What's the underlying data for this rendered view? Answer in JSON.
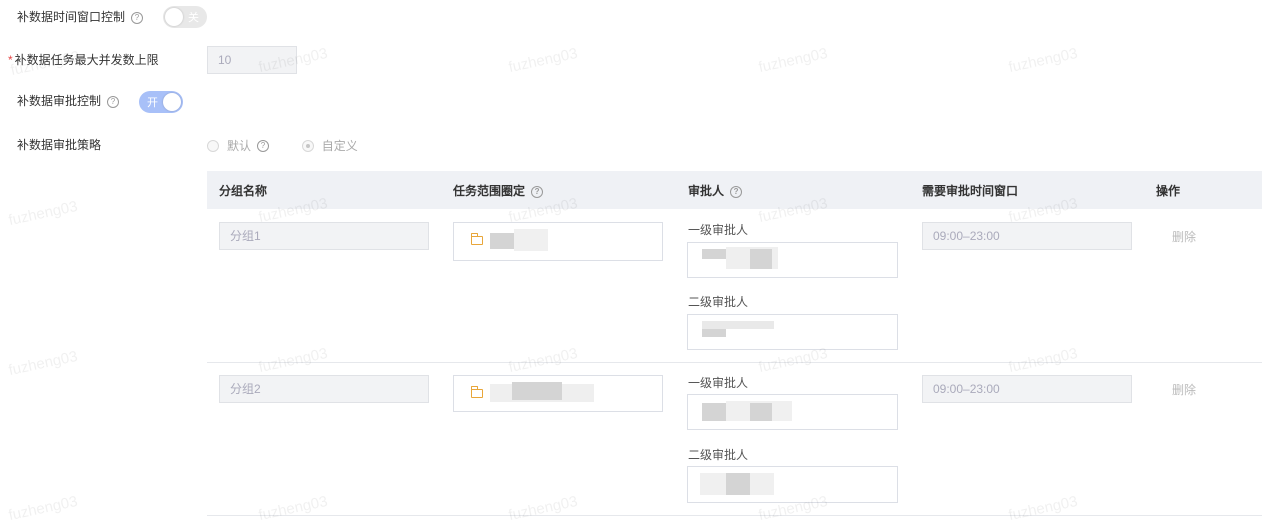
{
  "settings": {
    "time_window_label": "补数据时间窗口控制",
    "time_window_switch": "关",
    "max_concurrency_label": "补数据任务最大并发数上限",
    "max_concurrency_value": "10",
    "approval_control_label": "补数据审批控制",
    "approval_switch": "开",
    "approval_strategy_label": "补数据审批策略",
    "strategy_default": "默认",
    "strategy_custom": "自定义"
  },
  "table": {
    "headers": [
      "分组名称",
      "任务范围圈定",
      "审批人",
      "需要审批时间窗口",
      "操作"
    ],
    "approver_level1_label": "一级审批人",
    "approver_level2_label": "二级审批人",
    "rows": [
      {
        "group_name": "分组1",
        "time_window": "09:00–23:00",
        "action": "删除"
      },
      {
        "group_name": "分组2",
        "time_window": "09:00–23:00",
        "action": "删除"
      }
    ]
  },
  "watermark": "fuzheng03"
}
